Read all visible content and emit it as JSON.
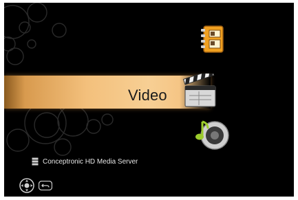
{
  "menu": {
    "selected_label": "Video",
    "items": [
      {
        "icon": "address-book-icon"
      },
      {
        "icon": "clapperboard-icon"
      },
      {
        "icon": "music-speaker-icon"
      }
    ]
  },
  "server": {
    "icon": "server-icon",
    "label": "Conceptronic HD Media Server"
  },
  "remote_hints": [
    {
      "icon": "dpad-icon"
    },
    {
      "icon": "back-arrow-icon"
    }
  ],
  "colors": {
    "background": "#000000",
    "highlight": "#f3c07c",
    "text": "#e6e6e6",
    "selected_text": "#1a1a1a"
  }
}
